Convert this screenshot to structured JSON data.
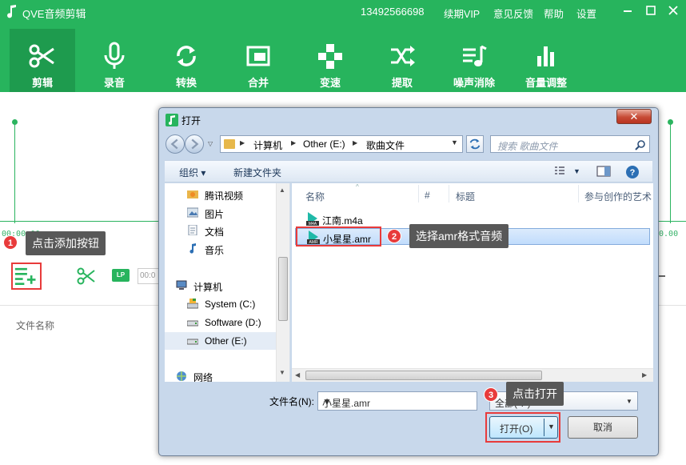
{
  "app": {
    "title": "QVE音频剪辑",
    "phone": "13492566698",
    "links": [
      "续期VIP",
      "意见反馈",
      "帮助",
      "设置"
    ],
    "brand_color": "#27b45d"
  },
  "toolbar": {
    "items": [
      {
        "label": "剪辑",
        "icon": "scissors-icon",
        "active": true
      },
      {
        "label": "录音",
        "icon": "microphone-icon"
      },
      {
        "label": "转换",
        "icon": "refresh-icon"
      },
      {
        "label": "合并",
        "icon": "merge-icon"
      },
      {
        "label": "变速",
        "icon": "speed-icon"
      },
      {
        "label": "提取",
        "icon": "shuffle-icon"
      },
      {
        "label": "噪声消除",
        "icon": "noise-icon"
      },
      {
        "label": "音量调整",
        "icon": "volume-bars-icon"
      }
    ]
  },
  "editor": {
    "time_start": "00:00.00",
    "time_end": "00.00",
    "time_field": "00:0",
    "file_name_header": "文件名称"
  },
  "callouts": {
    "step1": {
      "num": "1",
      "text": "点击添加按钮"
    },
    "step2": {
      "num": "2",
      "text": "选择amr格式音频"
    },
    "step3": {
      "num": "3",
      "text": "点击打开"
    }
  },
  "dialog": {
    "title": "打开",
    "breadcrumb": [
      "计算机",
      "Other (E:)",
      "歌曲文件"
    ],
    "search_placeholder": "搜索 歌曲文件",
    "commands": {
      "organize": "组织 ▾",
      "new_folder": "新建文件夹"
    },
    "nav_items": [
      {
        "label": "腾讯视频",
        "icon": "folder-video-icon"
      },
      {
        "label": "图片",
        "icon": "pictures-icon"
      },
      {
        "label": "文档",
        "icon": "documents-icon"
      },
      {
        "label": "音乐",
        "icon": "music-icon"
      },
      {
        "label": "计算机",
        "icon": "computer-icon"
      },
      {
        "label": "System (C:)",
        "icon": "drive-system-icon"
      },
      {
        "label": "Software (D:)",
        "icon": "drive-icon"
      },
      {
        "label": "Other (E:)",
        "icon": "drive-icon",
        "selected": true
      },
      {
        "label": "网络",
        "icon": "network-icon"
      }
    ],
    "columns": [
      "名称",
      "#",
      "标题",
      "参与创作的艺术"
    ],
    "files": [
      {
        "name": "江南.m4a",
        "icon": "m4a-file-icon"
      },
      {
        "name": "小星星.amr",
        "icon": "amr-file-icon",
        "selected": true
      }
    ],
    "filename_label": "文件名(N):",
    "filename_value": "小星星.amr",
    "filetype_value": "全部(*.*)",
    "open_label": "打开(O)",
    "cancel_label": "取消",
    "close_symbol": "✕"
  }
}
